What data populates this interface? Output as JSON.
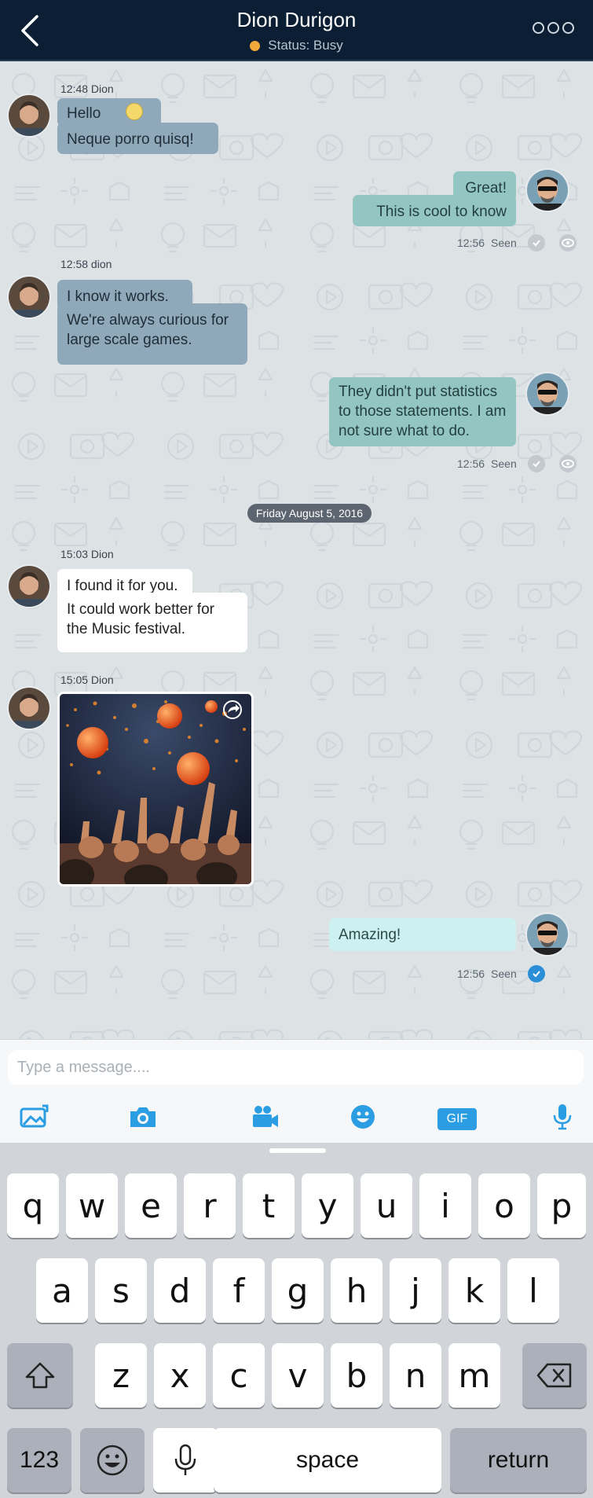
{
  "header": {
    "title": "Dion Durigon",
    "status": "Status: Busy",
    "status_color": "#f2a93b",
    "back_icon": "chevron-left-icon",
    "more_icon": "more-dots-icon"
  },
  "messages": {
    "m1": {
      "meta": "12:48 Dion",
      "line1": "Hello",
      "line2": "Neque porro quisq!"
    },
    "m2": {
      "line1": "Great!",
      "line2": "This is cool to know",
      "time": "12:56",
      "status": "Seen"
    },
    "m3": {
      "meta": "12:58 dion",
      "line1": "I know it works.",
      "line2": "We're always curious for large scale games."
    },
    "m4": {
      "text": "They didn't put statistics to those statements. I am not sure what to do.",
      "time": "12:56",
      "status": "Seen"
    },
    "date_divider": "Friday August 5, 2016",
    "m5": {
      "meta": "15:03 Dion",
      "line1": "I found it for you.",
      "line2": "It could work better for the Music festival."
    },
    "m6": {
      "meta": "15:05 Dion"
    },
    "m7": {
      "text": "Amazing!",
      "time": "12:56",
      "status": "Seen"
    }
  },
  "composer": {
    "placeholder": "Type a message....",
    "gif_label": "GIF"
  },
  "keyboard": {
    "row1": [
      "q",
      "w",
      "e",
      "r",
      "t",
      "y",
      "u",
      "i",
      "o",
      "p"
    ],
    "row2": [
      "a",
      "s",
      "d",
      "f",
      "g",
      "h",
      "j",
      "k",
      "l"
    ],
    "row3": [
      "z",
      "x",
      "c",
      "v",
      "b",
      "n",
      "m"
    ],
    "numbers_label": "123",
    "space_label": "space",
    "return_label": "return"
  },
  "colors": {
    "header_bg": "#0b1e33",
    "incoming_bubble": "#8fa9bb",
    "outgoing_bubble": "#93c5c2",
    "accent": "#2b9ee3"
  }
}
